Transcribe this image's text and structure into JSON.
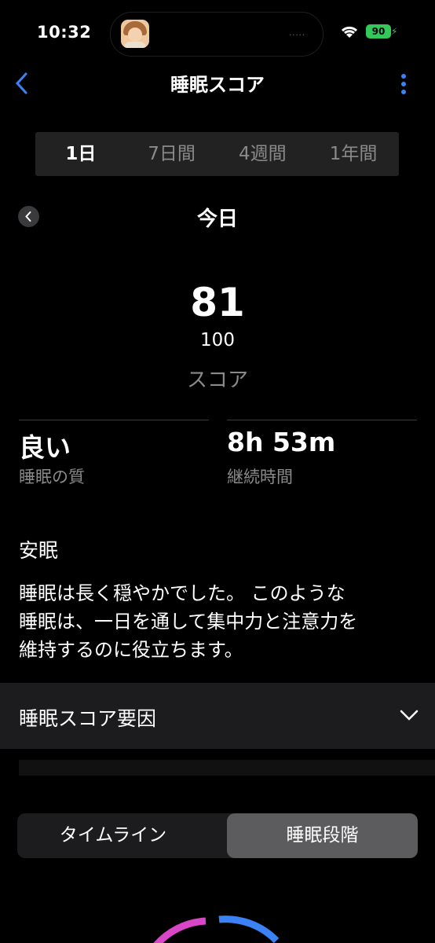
{
  "status": {
    "time": "10:32",
    "battery": "90"
  },
  "nav": {
    "title": "睡眠スコア"
  },
  "segments": [
    "1日",
    "7日間",
    "4週間",
    "1年間"
  ],
  "day": {
    "title": "今日"
  },
  "score": {
    "value": "81",
    "max": "100",
    "label": "スコア"
  },
  "stats": [
    {
      "value": "良い",
      "label": "睡眠の質"
    },
    {
      "value": "8h 53m",
      "label": "継続時間"
    }
  ],
  "insight": {
    "heading": "安眠",
    "lines": [
      "睡眠は長く穏やかでした。 このような",
      "睡眠は、一日を通して集中力と注意力を",
      "維持するのに役立ちます。"
    ]
  },
  "factors": {
    "label": "睡眠スコア要因"
  },
  "tabs": [
    "タイムライン",
    "睡眠段階"
  ],
  "colors": {
    "accent": "#3b82f6",
    "battery": "#34c759",
    "ring_pink": "#d946c8",
    "ring_blue": "#3b82f6"
  }
}
